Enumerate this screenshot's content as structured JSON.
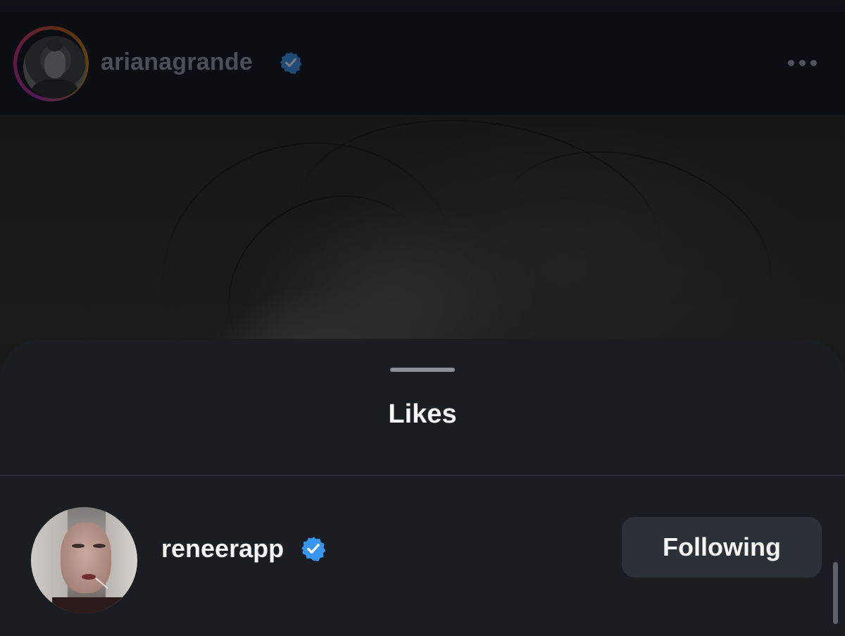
{
  "post": {
    "username": "arianagrande",
    "verified": true,
    "more_icon": "more-horizontal-icon"
  },
  "likes_sheet": {
    "title": "Likes",
    "users": [
      {
        "username": "reneerapp",
        "verified": true,
        "button_label": "Following"
      }
    ]
  },
  "colors": {
    "verified_badge": "#3797f0",
    "sheet_background": "#1a1d21",
    "button_background": "#2c3037",
    "text_primary": "#f5f5f5"
  }
}
